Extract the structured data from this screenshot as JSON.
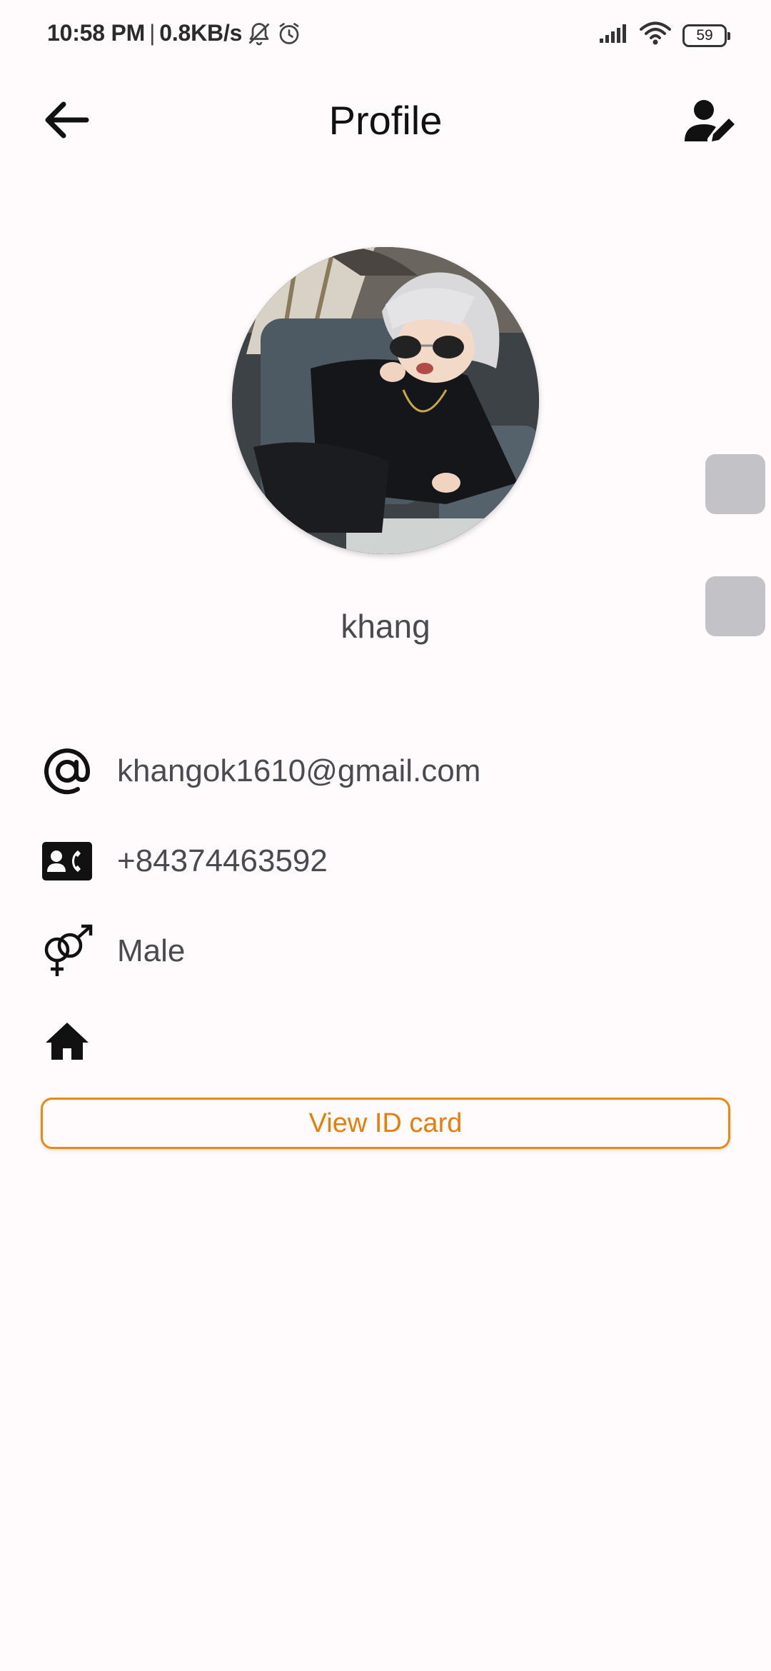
{
  "status_bar": {
    "time": "10:58 PM",
    "separator": "|",
    "net_speed": "0.8KB/s",
    "battery": "59",
    "icons": [
      "bell-mute-icon",
      "alarm-icon",
      "signal-icon",
      "wifi-icon",
      "battery-icon"
    ]
  },
  "app_bar": {
    "title": "Profile",
    "icons": [
      "arrow-left-icon",
      "user-edit-icon"
    ]
  },
  "profile": {
    "username": "khang",
    "email": "khangok1610@gmail.com",
    "phone": "+84374463592",
    "gender": "Male",
    "address": ""
  },
  "info_icons": [
    "at-icon",
    "contact-card-icon",
    "gender-icon",
    "home-icon"
  ],
  "buttons": {
    "view_id_card": "View ID card"
  },
  "colors": {
    "background": "#fffbfd",
    "accent": "#e67e0e",
    "text": "#4a4a4f",
    "side_handle": "#c3c2c6"
  }
}
